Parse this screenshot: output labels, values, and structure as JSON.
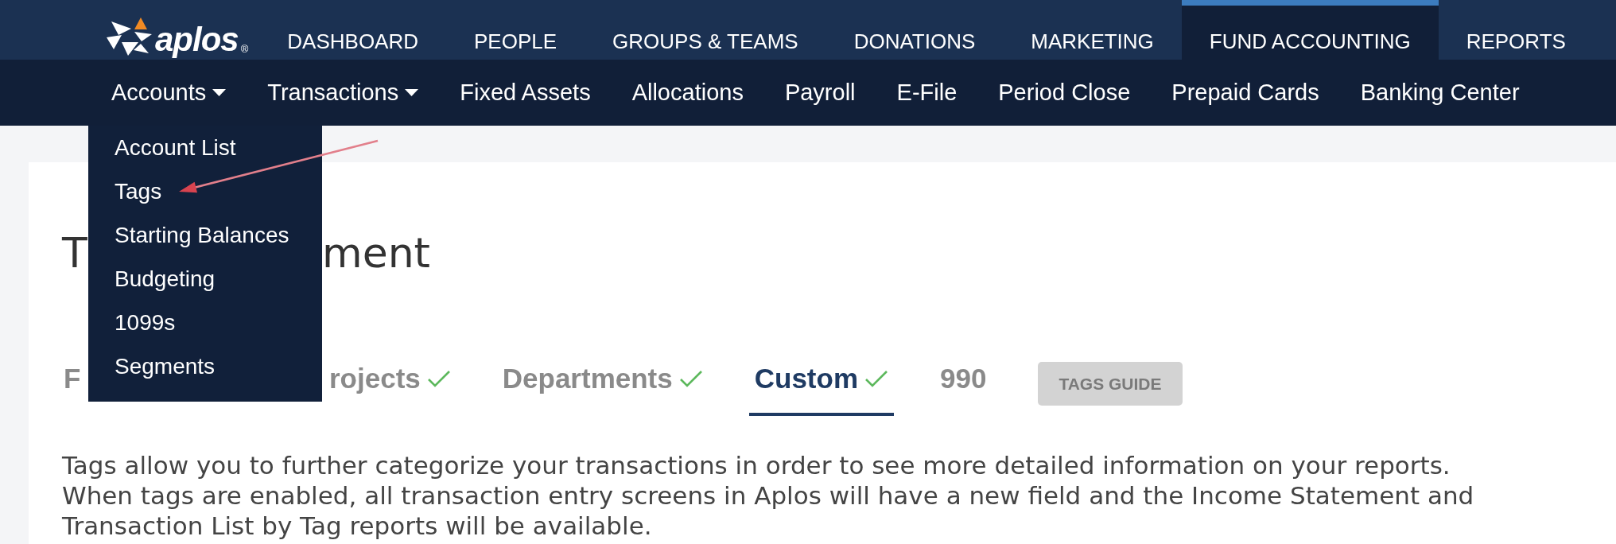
{
  "top_nav": {
    "logo": {
      "text": "aplos",
      "mark": "®"
    },
    "items": [
      {
        "label": "DASHBOARD",
        "selected": false
      },
      {
        "label": "PEOPLE",
        "selected": false
      },
      {
        "label": "GROUPS & TEAMS",
        "selected": false
      },
      {
        "label": "DONATIONS",
        "selected": false
      },
      {
        "label": "MARKETING",
        "selected": false
      },
      {
        "label": "FUND ACCOUNTING",
        "selected": true
      },
      {
        "label": "REPORTS",
        "selected": false
      }
    ]
  },
  "sub_nav": {
    "items": [
      {
        "label": "Accounts",
        "kind": "dropdown",
        "expanded": true,
        "menu": [
          "Account List",
          "Tags",
          "Starting Balances",
          "Budgeting",
          "1099s",
          "Segments"
        ]
      },
      {
        "label": "Transactions",
        "kind": "dropdown",
        "expanded": false
      },
      {
        "label": "Fixed Assets",
        "kind": "link"
      },
      {
        "label": "Allocations",
        "kind": "link"
      },
      {
        "label": "Payroll",
        "kind": "link"
      },
      {
        "label": "E-File",
        "kind": "link"
      },
      {
        "label": "Period Close",
        "kind": "link"
      },
      {
        "label": "Prepaid Cards",
        "kind": "link"
      },
      {
        "label": "Banking Center",
        "kind": "link"
      }
    ]
  },
  "page": {
    "heading": [
      "T",
      "ment"
    ],
    "tabs": [
      {
        "label": "F",
        "checked": false,
        "selected": false
      },
      {
        "label": "rojects",
        "checked": true,
        "selected": false
      },
      {
        "label": "Departments",
        "checked": true,
        "selected": false
      },
      {
        "label": "Custom",
        "checked": true,
        "selected": true
      },
      {
        "label": "990",
        "checked": false,
        "selected": false
      }
    ],
    "guide_button": "TAGS GUIDE",
    "description": "Tags allow you to further categorize your transactions in order to see more detailed information on your reports. When tags are enabled, all transaction entry screens in Aplos will have a new field and the Income Statement and Transaction List by Tag reports will be available."
  }
}
